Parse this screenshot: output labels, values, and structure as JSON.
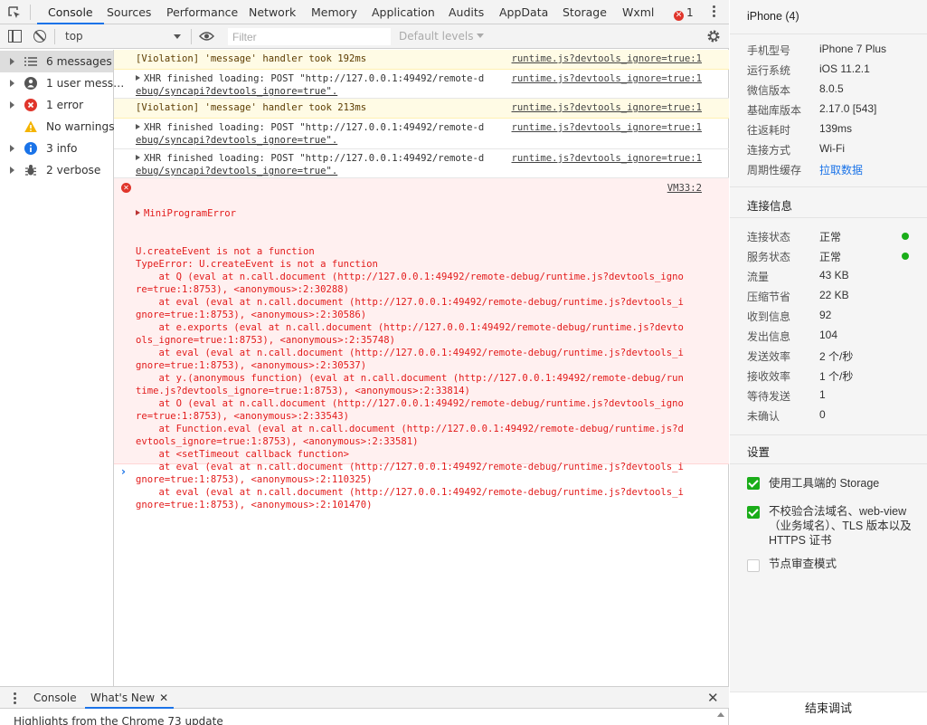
{
  "tabs": [
    "Console",
    "Sources",
    "Performance",
    "Network",
    "Memory",
    "Application",
    "Audits",
    "AppData",
    "Storage",
    "Wxml"
  ],
  "error_count": "1",
  "toolbar": {
    "context": "top",
    "filter_placeholder": "Filter",
    "levels": "Default levels"
  },
  "sidebar": {
    "items": [
      {
        "label": "6 messages",
        "icon": "list-icon"
      },
      {
        "label": "1 user mess…",
        "icon": "user-icon"
      },
      {
        "label": "1 error",
        "icon": "error-icon"
      },
      {
        "label": "No warnings",
        "icon": "warning-icon"
      },
      {
        "label": "3 info",
        "icon": "info-icon"
      },
      {
        "label": "2 verbose",
        "icon": "bug-icon"
      }
    ]
  },
  "messages": [
    {
      "lines": [
        "[Violation] 'message' handler took 192ms"
      ],
      "source": "runtime.js?devtools_ignore=true:1"
    },
    {
      "lines": [
        "XHR finished loading: POST \"http://127.0.0.1:49492/remote-d",
        "ebug/syncapi?devtools_ignore=true\"."
      ],
      "source": "runtime.js?devtools_ignore=true:1"
    },
    {
      "lines": [
        "[Violation] 'message' handler took 213ms"
      ],
      "source": "runtime.js?devtools_ignore=true:1"
    },
    {
      "lines": [
        "XHR finished loading: POST \"http://127.0.0.1:49492/remote-d",
        "ebug/syncapi?devtools_ignore=true\"."
      ],
      "source": "runtime.js?devtools_ignore=true:1"
    },
    {
      "lines": [
        "XHR finished loading: POST \"http://127.0.0.1:49492/remote-d",
        "ebug/syncapi?devtools_ignore=true\"."
      ],
      "source": "runtime.js?devtools_ignore=true:1"
    }
  ],
  "error": {
    "title": "MiniProgramError",
    "source": "VM33:2",
    "lines": [
      "U.createEvent is not a function",
      "TypeError: U.createEvent is not a function",
      "    at Q (eval at n.call.document (http://127.0.0.1:49492/remote-debug/runtime.js?devtools_igno",
      "re=true:1:8753), <anonymous>:2:30288)",
      "    at eval (eval at n.call.document (http://127.0.0.1:49492/remote-debug/runtime.js?devtools_i",
      "gnore=true:1:8753), <anonymous>:2:30586)",
      "    at e.exports (eval at n.call.document (http://127.0.0.1:49492/remote-debug/runtime.js?devto",
      "ols_ignore=true:1:8753), <anonymous>:2:35748)",
      "    at eval (eval at n.call.document (http://127.0.0.1:49492/remote-debug/runtime.js?devtools_i",
      "gnore=true:1:8753), <anonymous>:2:30537)",
      "    at y.(anonymous function) (eval at n.call.document (http://127.0.0.1:49492/remote-debug/run",
      "time.js?devtools_ignore=true:1:8753), <anonymous>:2:33814)",
      "    at O (eval at n.call.document (http://127.0.0.1:49492/remote-debug/runtime.js?devtools_igno",
      "re=true:1:8753), <anonymous>:2:33543)",
      "    at Function.eval (eval at n.call.document (http://127.0.0.1:49492/remote-debug/runtime.js?d",
      "evtools_ignore=true:1:8753), <anonymous>:2:33581)",
      "    at <setTimeout callback function>",
      "    at eval (eval at n.call.document (http://127.0.0.1:49492/remote-debug/runtime.js?devtools_i",
      "gnore=true:1:8753), <anonymous>:2:110325)",
      "    at eval (eval at n.call.document (http://127.0.0.1:49492/remote-debug/runtime.js?devtools_i",
      "gnore=true:1:8753), <anonymous>:2:101470)"
    ]
  },
  "prompt": "›",
  "drawer": {
    "tabs": [
      "Console",
      "What's New"
    ],
    "close": "✕",
    "tab_close": "✕",
    "content": "Highlights from the Chrome 73 update"
  },
  "panel": {
    "device_title": "iPhone (4)",
    "device_info": [
      {
        "key": "手机型号",
        "value": "iPhone 7 Plus"
      },
      {
        "key": "运行系统",
        "value": "iOS 11.2.1"
      },
      {
        "key": "微信版本",
        "value": "8.0.5"
      },
      {
        "key": "基础库版本",
        "value": "2.17.0 [543]"
      },
      {
        "key": "往返耗时",
        "value": "139ms"
      },
      {
        "key": "连接方式",
        "value": "Wi-Fi"
      },
      {
        "key": "周期性缓存",
        "value": "拉取数据"
      }
    ],
    "connection_title": "连接信息",
    "connection_info": [
      {
        "key": "连接状态",
        "value": "正常",
        "status": "ok"
      },
      {
        "key": "服务状态",
        "value": "正常",
        "status": "ok"
      },
      {
        "key": "流量",
        "value": "43 KB"
      },
      {
        "key": "压缩节省",
        "value": "22 KB"
      },
      {
        "key": "收到信息",
        "value": "92"
      },
      {
        "key": "发出信息",
        "value": "104"
      },
      {
        "key": "发送效率",
        "value": "2 个/秒"
      },
      {
        "key": "接收效率",
        "value": "1 个/秒"
      },
      {
        "key": "等待发送",
        "value": "1"
      },
      {
        "key": "未确认",
        "value": "0"
      }
    ],
    "settings_title": "设置",
    "settings": [
      {
        "label": "使用工具端的 Storage",
        "checked": true
      },
      {
        "label": "不校验合法域名、web-view（业务域名）、TLS 版本以及 HTTPS 证书",
        "checked": true
      },
      {
        "label": "节点审查模式",
        "checked": false
      }
    ],
    "end_button": "结束调试"
  },
  "colors": {
    "accent": "#1a73e8",
    "error": "#e21b1b",
    "warning_bg": "#fffbe5",
    "error_bg": "#fff0f0",
    "success": "#1aad19"
  }
}
